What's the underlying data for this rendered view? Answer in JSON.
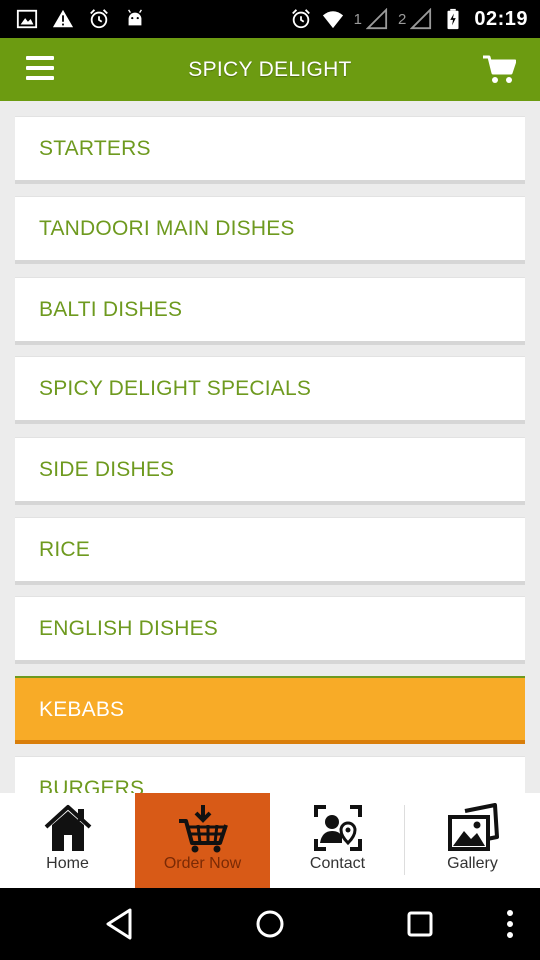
{
  "status_bar": {
    "time": "02:19",
    "sim1": "1",
    "sim2": "2"
  },
  "app_bar": {
    "title": "SPICY DELIGHT"
  },
  "categories": [
    {
      "label": "STARTERS",
      "selected": false
    },
    {
      "label": "TANDOORI MAIN DISHES",
      "selected": false
    },
    {
      "label": "BALTI DISHES",
      "selected": false
    },
    {
      "label": "SPICY DELIGHT SPECIALS",
      "selected": false
    },
    {
      "label": "SIDE DISHES",
      "selected": false
    },
    {
      "label": "RICE",
      "selected": false
    },
    {
      "label": "ENGLISH DISHES",
      "selected": false
    },
    {
      "label": "KEBABS",
      "selected": true
    },
    {
      "label": "BURGERS",
      "selected": false
    }
  ],
  "tabs": [
    {
      "label": "Home",
      "icon": "home-icon",
      "active": false
    },
    {
      "label": "Order Now",
      "icon": "basket-icon",
      "active": true
    },
    {
      "label": "Contact",
      "icon": "contact-icon",
      "active": false
    },
    {
      "label": "Gallery",
      "icon": "gallery-icon",
      "active": false
    }
  ],
  "colors": {
    "brand_green": "#6c9b11",
    "selected_orange": "#f8ab27",
    "active_tab": "#d85a17"
  }
}
